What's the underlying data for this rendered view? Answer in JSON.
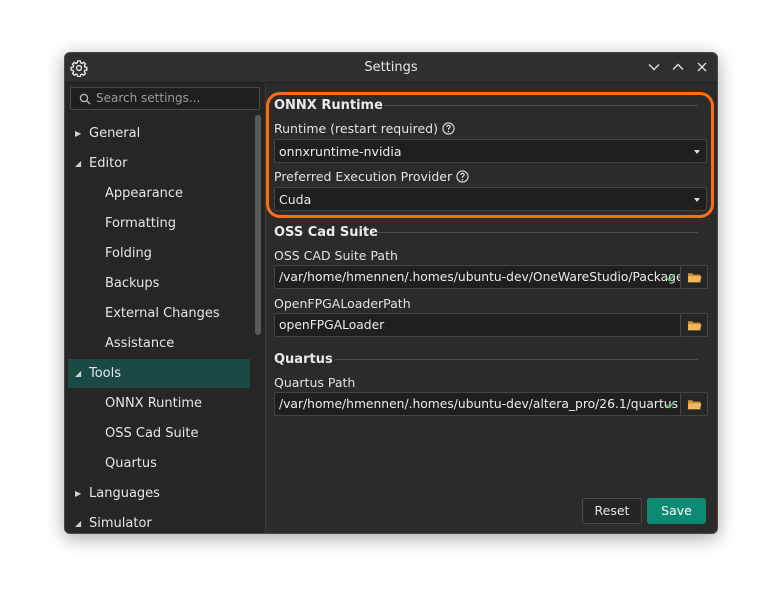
{
  "window": {
    "title": "Settings"
  },
  "sidebar": {
    "search_placeholder": "Search settings...",
    "items": [
      {
        "label": "General",
        "expanded": false
      },
      {
        "label": "Editor",
        "expanded": true
      },
      {
        "label": "Appearance"
      },
      {
        "label": "Formatting"
      },
      {
        "label": "Folding"
      },
      {
        "label": "Backups"
      },
      {
        "label": "External Changes"
      },
      {
        "label": "Assistance"
      },
      {
        "label": "Tools",
        "expanded": true,
        "selected": true
      },
      {
        "label": "ONNX Runtime"
      },
      {
        "label": "OSS Cad Suite"
      },
      {
        "label": "Quartus"
      },
      {
        "label": "Languages",
        "expanded": false
      },
      {
        "label": "Simulator",
        "expanded": true
      }
    ]
  },
  "sections": {
    "onnx": {
      "title": "ONNX Runtime",
      "runtime_label": "Runtime (restart required)",
      "runtime_value": "onnxruntime-nvidia",
      "provider_label": "Preferred Execution Provider",
      "provider_value": "Cuda"
    },
    "oss": {
      "title": "OSS Cad Suite",
      "path_label": "OSS CAD Suite Path",
      "path_value": "/var/home/hmennen/.homes/ubuntu-dev/OneWareStudio/Packages",
      "loader_label": "OpenFPGALoaderPath",
      "loader_value": "openFPGALoader"
    },
    "quartus": {
      "title": "Quartus",
      "path_label": "Quartus Path",
      "path_value": "/var/home/hmennen/.homes/ubuntu-dev/altera_pro/26.1/quartus"
    }
  },
  "footer": {
    "reset_label": "Reset",
    "save_label": "Save"
  },
  "colors": {
    "accent": "#0e8a72",
    "highlight": "#ff6d13",
    "valid_check": "#3ec46d",
    "folder": "#f0b85a"
  }
}
